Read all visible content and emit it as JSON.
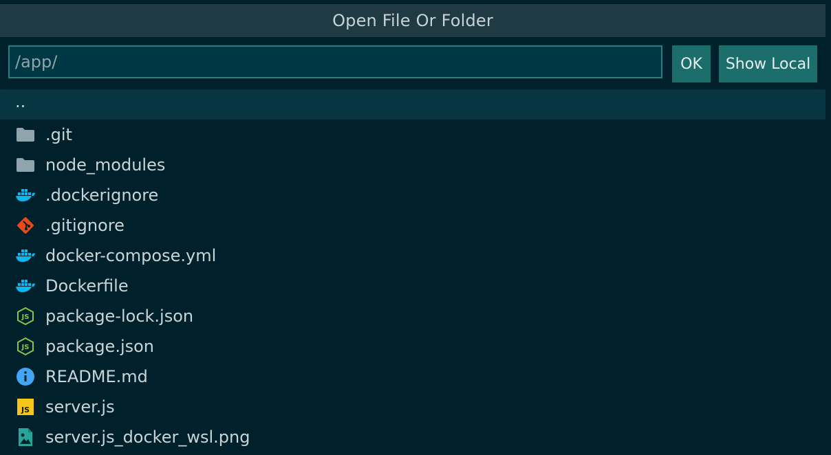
{
  "dialog": {
    "title": "Open File Or Folder",
    "path_value": "/app/",
    "ok_label": "OK",
    "show_local_label": "Show Local"
  },
  "colors": {
    "background": "#00212b",
    "titlebar": "#1f3a42",
    "input_bg": "#003744",
    "input_border": "#2a7d80",
    "button_bg": "#1b6e6b",
    "selected_row": "#073642",
    "folder_icon": "#90a4ae",
    "docker_icon": "#0db7ed",
    "git_icon": "#e64a19",
    "node_icon": "#8bc34a",
    "info_icon": "#42a5f5",
    "js_icon": "#f5c518",
    "image_icon": "#26a69a"
  },
  "files": {
    "parent": "..",
    "items": [
      {
        "name": ".git",
        "icon": "folder-icon"
      },
      {
        "name": "node_modules",
        "icon": "folder-icon"
      },
      {
        "name": ".dockerignore",
        "icon": "docker-icon"
      },
      {
        "name": ".gitignore",
        "icon": "git-icon"
      },
      {
        "name": "docker-compose.yml",
        "icon": "docker-icon"
      },
      {
        "name": "Dockerfile",
        "icon": "docker-icon"
      },
      {
        "name": "package-lock.json",
        "icon": "nodejs-icon"
      },
      {
        "name": "package.json",
        "icon": "nodejs-icon"
      },
      {
        "name": "README.md",
        "icon": "info-icon"
      },
      {
        "name": "server.js",
        "icon": "javascript-icon"
      },
      {
        "name": "server.js_docker_wsl.png",
        "icon": "image-icon"
      }
    ]
  }
}
